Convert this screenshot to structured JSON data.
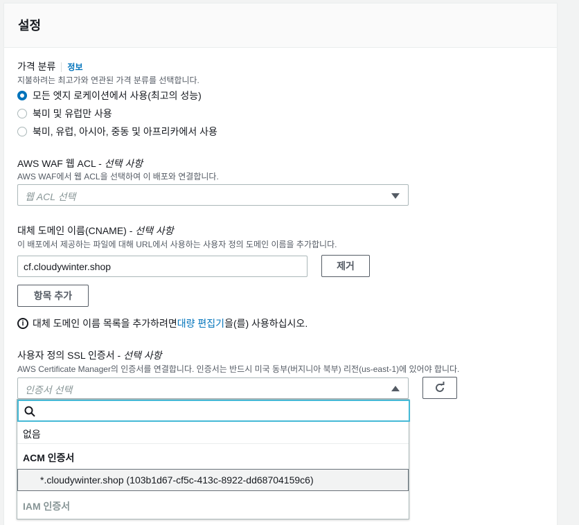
{
  "panel": {
    "title": "설정"
  },
  "price_class": {
    "label": "가격 분류",
    "info": "정보",
    "description": "지불하려는 최고가와 연관된 가격 분류를 선택합니다.",
    "options": [
      {
        "label": "모든 엣지 로케이션에서 사용(최고의 성능)",
        "checked": true
      },
      {
        "label": "북미 및 유럽만 사용",
        "checked": false
      },
      {
        "label": "북미, 유럽, 아시아, 중동 및 아프리카에서 사용",
        "checked": false
      }
    ]
  },
  "waf": {
    "label": "AWS WAF 웹 ACL - ",
    "optional": "선택 사항",
    "description": "AWS WAF에서 웹 ACL을 선택하여 이 배포와 연결합니다.",
    "placeholder": "웹 ACL 선택"
  },
  "cname": {
    "label": "대체 도메인 이름(CNAME) - ",
    "optional": "선택 사항",
    "description": "이 배포에서 제공하는 파일에 대해 URL에서 사용하는 사용자 정의 도메인 이름을 추가합니다.",
    "value": "cf.cloudywinter.shop",
    "remove_label": "제거",
    "add_label": "항목 추가"
  },
  "bulk_info": {
    "before": "대체 도메인 이름 목록을 추가하려면 ",
    "link": "대량 편집기",
    "after": "을(를) 사용하십시오."
  },
  "ssl": {
    "label": "사용자 정의 SSL 인증서 - ",
    "optional": "선택 사항",
    "description": "AWS Certificate Manager의 인증서를 연결합니다. 인증서는 반드시 미국 동부(버지니아 북부) 리전(us-east-1)에 있어야 합니다.",
    "placeholder": "인증서 선택"
  },
  "dropdown": {
    "search_value": "",
    "none_label": "없음",
    "acm_group": "ACM 인증서",
    "acm_item": "*.cloudywinter.shop (103b1d67-cf5c-413c-8922-dd68704159c6)",
    "iam_group": "IAM 인증서"
  },
  "colors": {
    "accent": "#0073bb",
    "focus": "#44b9d6"
  }
}
